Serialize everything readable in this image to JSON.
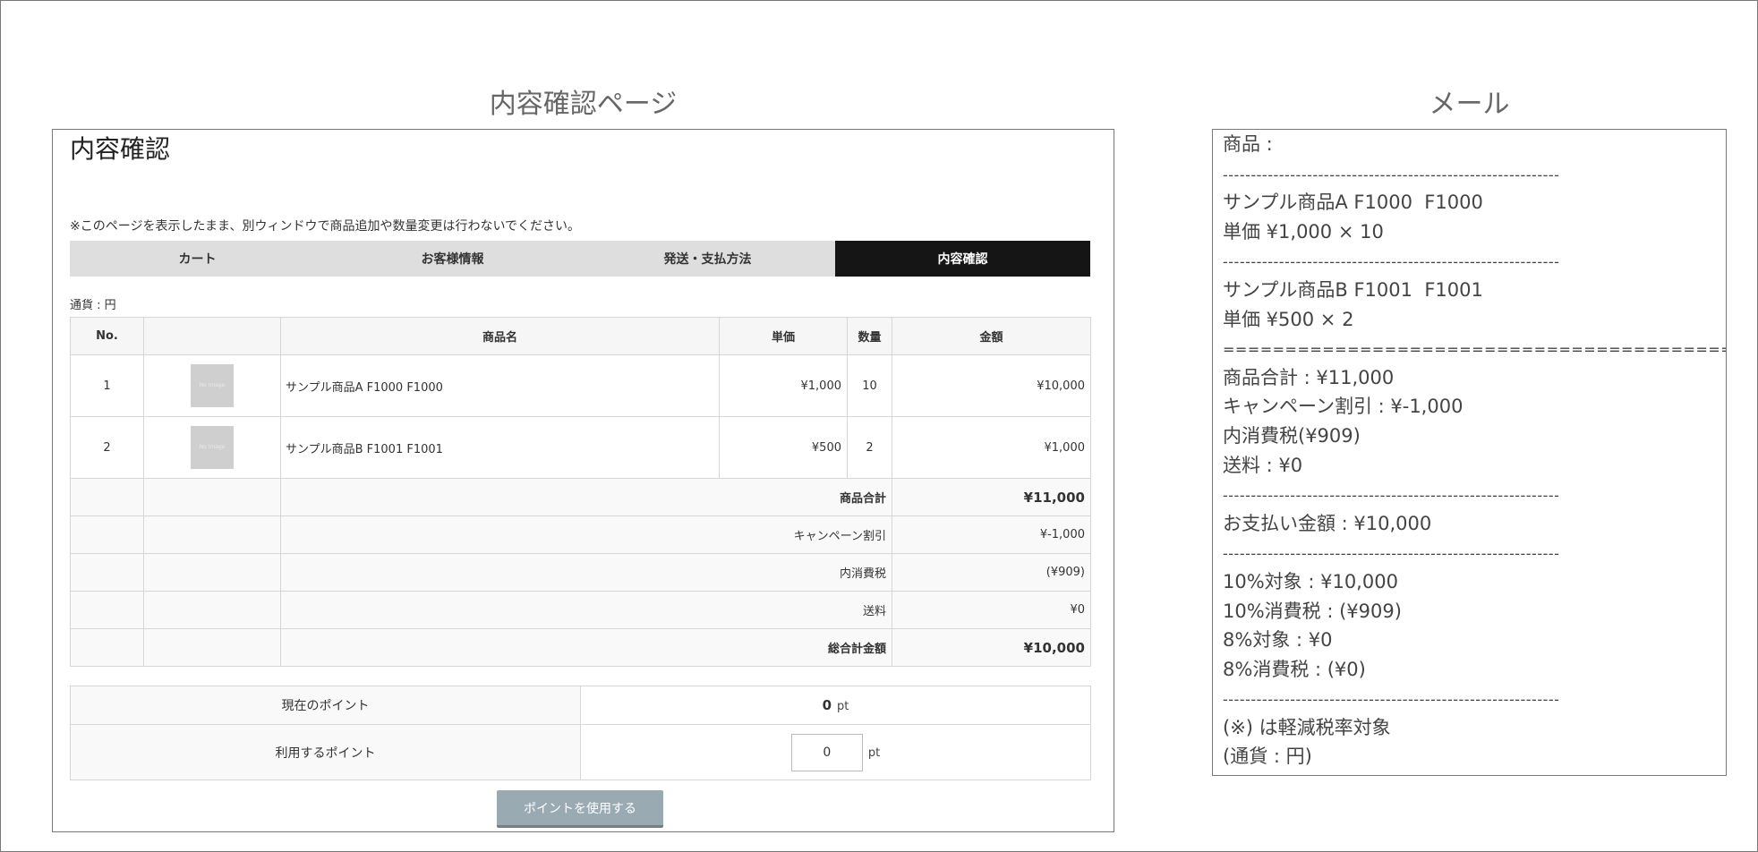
{
  "headings": {
    "left": "内容確認ページ",
    "right": "メール"
  },
  "page": {
    "title": "内容確認",
    "notice": "※このページを表示したまま、別ウィンドウで商品追加や数量変更は行わないでください。",
    "steps": [
      "カート",
      "お客様情報",
      "発送・支払方法",
      "内容確認"
    ],
    "active_step": 3,
    "currency": "通貨 : 円",
    "table": {
      "headers": [
        "No.",
        "",
        "商品名",
        "単価",
        "数量",
        "金額"
      ],
      "items": [
        {
          "no": "1",
          "image": "No Image",
          "name": "サンプル商品A F1000 F1000",
          "unit_price": "¥1,000",
          "qty": "10",
          "amount": "¥10,000"
        },
        {
          "no": "2",
          "image": "No Image",
          "name": "サンプル商品B F1001 F1001",
          "unit_price": "¥500",
          "qty": "2",
          "amount": "¥1,000"
        }
      ],
      "summary": [
        {
          "label": "商品合計",
          "value": "¥11,000"
        },
        {
          "label": "キャンペーン割引",
          "value": "¥-1,000"
        },
        {
          "label": "内消費税",
          "value": "(¥909)"
        },
        {
          "label": "送料",
          "value": "¥0"
        },
        {
          "label": "総合計金額",
          "value": "¥10,000"
        }
      ]
    },
    "points": {
      "current_label": "現在のポイント",
      "current_value": "0",
      "unit": "pt",
      "use_label": "利用するポイント",
      "use_value": "0",
      "button": "ポイントを使用する"
    }
  },
  "mail": {
    "lines": [
      "商品 :",
      "------------------------------------------------------------",
      "サンプル商品A F1000  F1000",
      "単価 ¥1,000 × 10",
      "------------------------------------------------------------",
      "サンプル商品B F1001  F1001",
      "単価 ¥500 × 2",
      "============================================",
      "商品合計 : ¥11,000",
      "キャンペーン割引 : ¥-1,000",
      "内消費税(¥909)",
      "送料 : ¥0",
      "------------------------------------------------------------",
      "お支払い金額 : ¥10,000",
      "------------------------------------------------------------",
      "10%対象 : ¥10,000",
      "10%消費税 : (¥909)",
      "8%対象 : ¥0",
      "8%消費税 : (¥0)",
      "------------------------------------------------------------",
      "(※) は軽減税率対象",
      "(通貨 : 円)"
    ]
  },
  "colors": {
    "price_red": "#c7000b",
    "active_step_bg": "#151515",
    "step_bg": "#dedede",
    "button_bg": "#9aaab3"
  }
}
